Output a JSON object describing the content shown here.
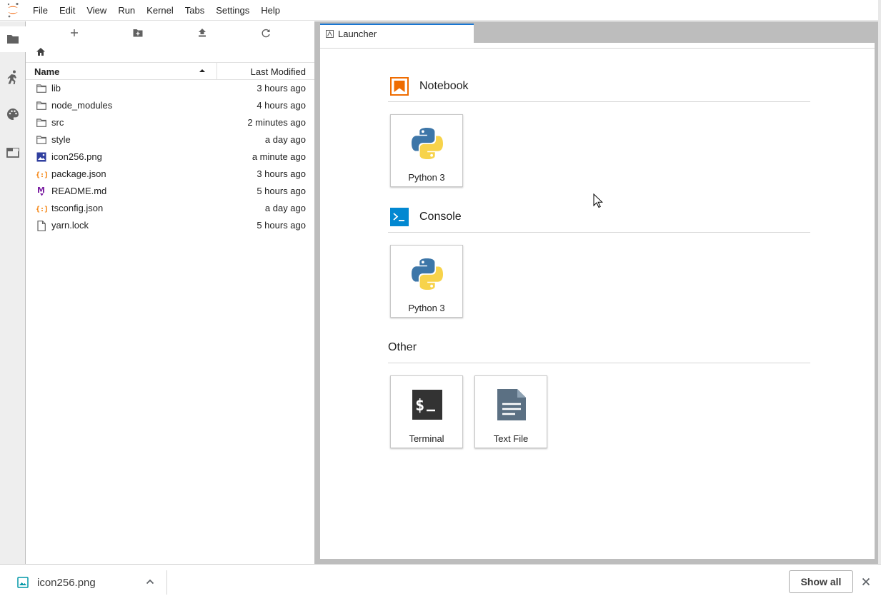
{
  "menubar": {
    "logo_icon": "jupyter-logo",
    "items": [
      "File",
      "Edit",
      "View",
      "Run",
      "Kernel",
      "Tabs",
      "Settings",
      "Help"
    ]
  },
  "activity_bar": {
    "icons": [
      "folder-icon",
      "running-icon",
      "palette-icon",
      "tabs-icon"
    ]
  },
  "file_browser": {
    "toolbar": [
      "new-launcher-icon",
      "new-folder-icon",
      "upload-icon",
      "refresh-icon"
    ],
    "breadcrumb_icon": "home-icon",
    "columns": {
      "name": "Name",
      "modified": "Last Modified"
    },
    "files": [
      {
        "name": "lib",
        "modified": "3 hours ago",
        "type": "folder"
      },
      {
        "name": "node_modules",
        "modified": "4 hours ago",
        "type": "folder"
      },
      {
        "name": "src",
        "modified": "2 minutes ago",
        "type": "folder"
      },
      {
        "name": "style",
        "modified": "a day ago",
        "type": "folder"
      },
      {
        "name": "icon256.png",
        "modified": "a minute ago",
        "type": "image"
      },
      {
        "name": "package.json",
        "modified": "3 hours ago",
        "type": "json"
      },
      {
        "name": "README.md",
        "modified": "5 hours ago",
        "type": "markdown"
      },
      {
        "name": "tsconfig.json",
        "modified": "a day ago",
        "type": "json"
      },
      {
        "name": "yarn.lock",
        "modified": "5 hours ago",
        "type": "file"
      }
    ]
  },
  "tabs": [
    {
      "label": "Launcher",
      "active": true
    }
  ],
  "launcher": {
    "sections": [
      {
        "title": "Notebook",
        "cards": [
          {
            "label": "Python 3",
            "icon": "python-icon"
          }
        ]
      },
      {
        "title": "Console",
        "cards": [
          {
            "label": "Python 3",
            "icon": "python-icon"
          }
        ]
      },
      {
        "title": "Other",
        "cards": [
          {
            "label": "Terminal",
            "icon": "terminal-icon"
          },
          {
            "label": "Text File",
            "icon": "text-file-icon"
          }
        ]
      }
    ]
  },
  "download_bar": {
    "file_name": "icon256.png",
    "show_all_label": "Show all"
  },
  "colors": {
    "accent": "#1976d2",
    "jupyter_orange": "#f37726",
    "notebook_orange": "#ef6c00",
    "console_blue": "#0288d1",
    "json_orange": "#f57c00",
    "markdown_purple": "#7b1fa2",
    "image_blue": "#303f9f"
  }
}
